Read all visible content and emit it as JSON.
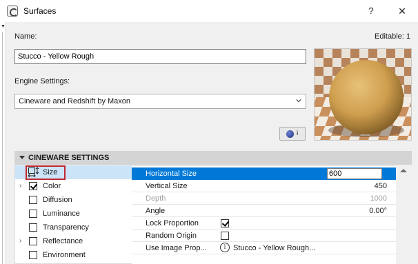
{
  "window": {
    "title": "Surfaces",
    "help_label": "?",
    "close_label": "✕"
  },
  "form": {
    "name_label": "Name:",
    "editable_label": "Editable: 1",
    "name_value": "Stucco - Yellow Rough",
    "engine_label": "Engine Settings:",
    "engine_value": "Cineware and Redshift by Maxon",
    "info_button_label": "i"
  },
  "section": {
    "title": "CINEWARE SETTINGS"
  },
  "channels": [
    {
      "label": "Size",
      "checked": false,
      "expandable": false,
      "selected": true,
      "icon": "size-icon"
    },
    {
      "label": "Color",
      "checked": true,
      "expandable": true,
      "selected": false
    },
    {
      "label": "Diffusion",
      "checked": false,
      "expandable": false,
      "selected": false
    },
    {
      "label": "Luminance",
      "checked": false,
      "expandable": false,
      "selected": false
    },
    {
      "label": "Transparency",
      "checked": false,
      "expandable": false,
      "selected": false
    },
    {
      "label": "Reflectance",
      "checked": false,
      "expandable": true,
      "selected": false
    },
    {
      "label": "Environment",
      "checked": false,
      "expandable": false,
      "selected": false
    }
  ],
  "properties": [
    {
      "label": "Horizontal Size",
      "value": "600",
      "selected": true,
      "editing": true
    },
    {
      "label": "Vertical Size",
      "value": "450"
    },
    {
      "label": "Depth",
      "value": "1000",
      "disabled": true
    },
    {
      "label": "Angle",
      "value": "0.00°"
    },
    {
      "label": "Lock Proportion",
      "checked": true
    },
    {
      "label": "Random Origin",
      "checked": false
    },
    {
      "label": "Use Image Prop...",
      "value": "Stucco - Yellow Rough...",
      "info_icon": true
    }
  ],
  "colors": {
    "selection_blue": "#0078d7",
    "channel_highlight": "#cce4f7",
    "highlight_frame": "#c0272d",
    "section_header": "#d4d4d4"
  }
}
